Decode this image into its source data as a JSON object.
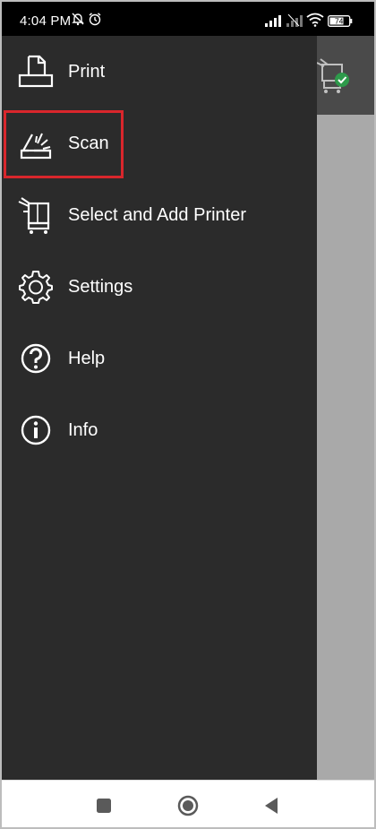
{
  "status_bar": {
    "time": "4:04 PM",
    "battery": "74",
    "icons": [
      "mute-notifications-icon",
      "alarm-icon",
      "signal-icon",
      "signal-2-icon",
      "wifi-icon",
      "battery-icon"
    ]
  },
  "drawer": {
    "items": [
      {
        "label": "Print",
        "icon": "print-icon"
      },
      {
        "label": "Scan",
        "icon": "scan-icon"
      },
      {
        "label": "Select and Add Printer",
        "icon": "printer-select-icon"
      },
      {
        "label": "Settings",
        "icon": "gear-icon"
      },
      {
        "label": "Help",
        "icon": "help-icon"
      },
      {
        "label": "Info",
        "icon": "info-icon"
      }
    ],
    "highlighted_item": "Scan"
  },
  "nav_bar": {
    "buttons": [
      "recent-apps-icon",
      "home-icon",
      "back-icon"
    ]
  },
  "colors": {
    "drawer_bg": "#2b2b2b",
    "highlight": "#d9262c",
    "check_green": "#2e9a4b"
  }
}
